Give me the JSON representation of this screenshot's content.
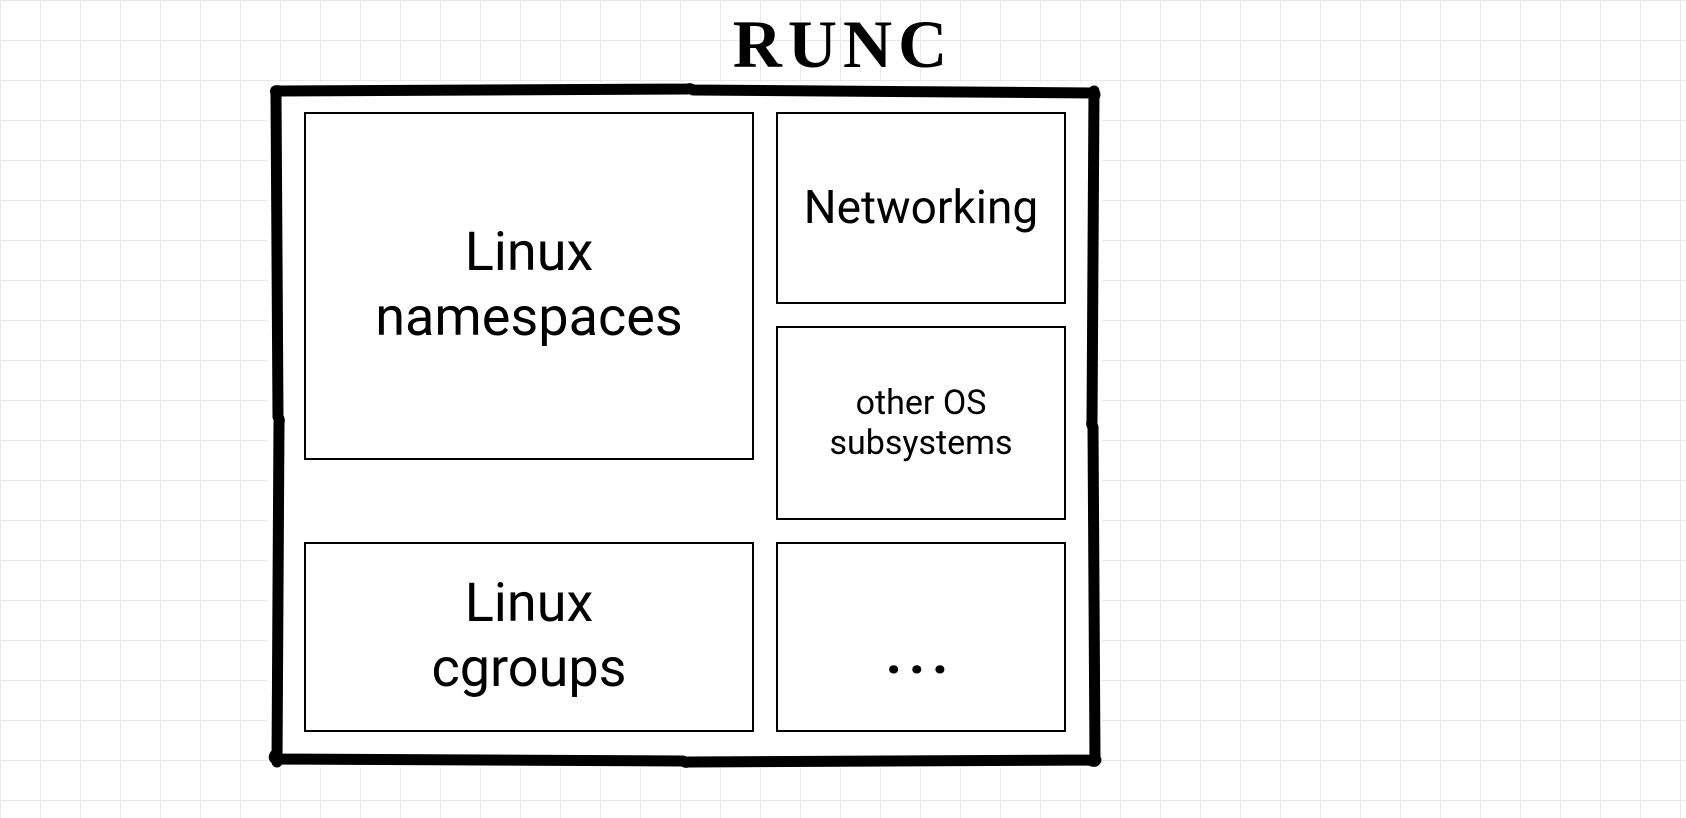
{
  "title": "RUNC",
  "boxes": {
    "namespaces": "Linux\nnamespaces",
    "cgroups": "Linux\ncgroups",
    "networking": "Networking",
    "other": "other OS subsystems",
    "dots": "..."
  }
}
